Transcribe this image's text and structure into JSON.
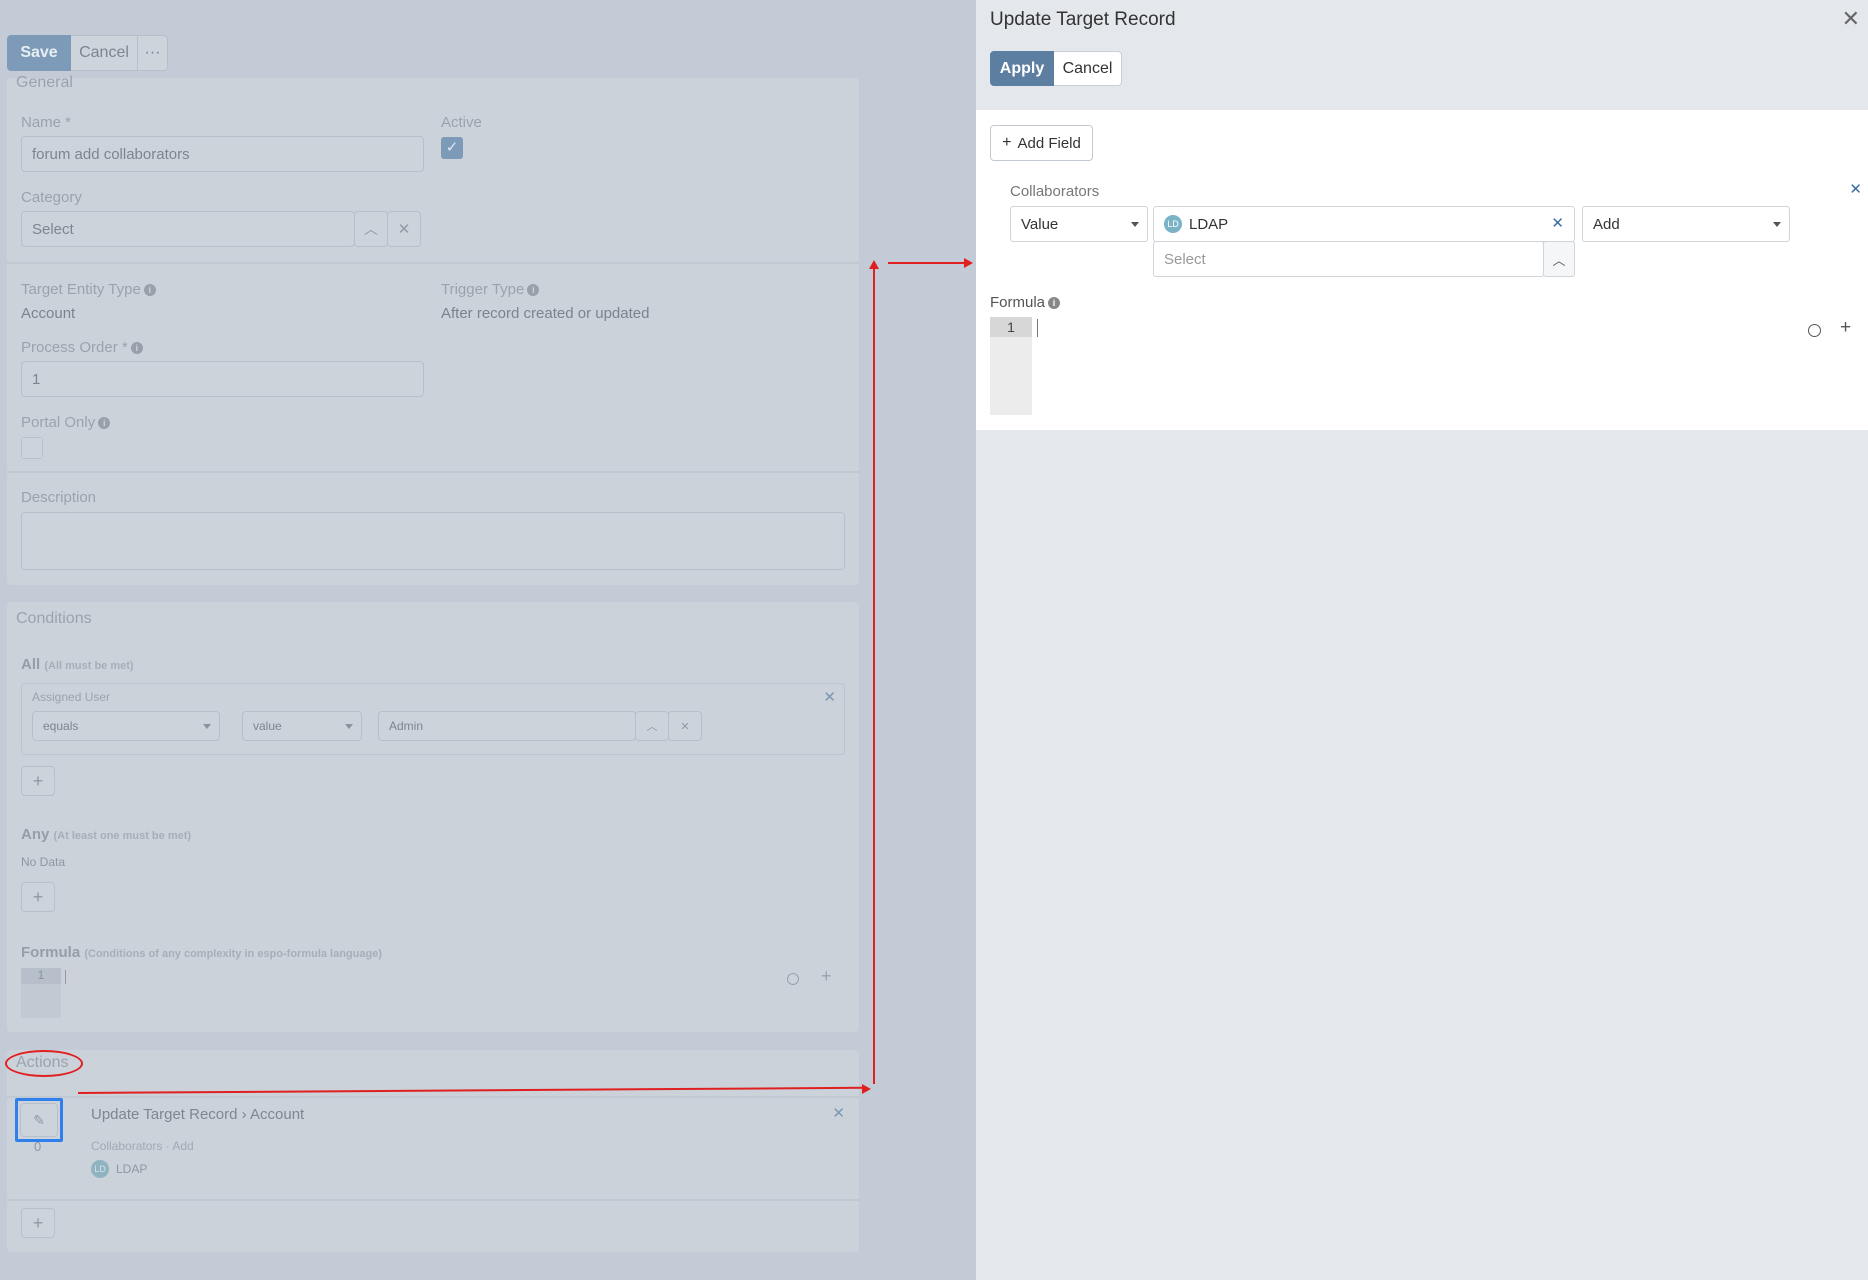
{
  "toolbar": {
    "save": "Save",
    "cancel": "Cancel",
    "more": "···"
  },
  "general": {
    "title": "General",
    "name_label": "Name *",
    "name_value": "forum add collaborators",
    "active_label": "Active",
    "category_label": "Category",
    "category_placeholder": "Select",
    "target_entity_label": "Target Entity Type",
    "target_entity_value": "Account",
    "trigger_type_label": "Trigger Type",
    "trigger_type_value": "After record created or updated",
    "process_order_label": "Process Order *",
    "process_order_value": "1",
    "portal_only_label": "Portal Only",
    "description_label": "Description"
  },
  "conditions": {
    "title": "Conditions",
    "all_label": "All",
    "all_note": "(All must be met)",
    "assigned_user_label": "Assigned User",
    "operator_value": "equals",
    "value_type": "value",
    "user_value": "Admin",
    "any_label": "Any",
    "any_note": "(At least one must be met)",
    "no_data": "No Data",
    "formula_label": "Formula",
    "formula_note": "(Conditions of any complexity in espo-formula language)",
    "line_number": "1"
  },
  "actions": {
    "title": "Actions",
    "action_title": "Update Target Record",
    "action_sep": "›",
    "action_entity": "Account",
    "action_sub": "Collaborators · Add",
    "badge_initials": "LD",
    "badge_label": "LDAP",
    "index": "0"
  },
  "modal": {
    "title": "Update Target Record",
    "apply": "Apply",
    "cancel": "Cancel",
    "add_field": "Add Field",
    "field_label": "Collaborators",
    "value_type": "Value",
    "selected_initials": "LD",
    "selected_value": "LDAP",
    "select_placeholder": "Select",
    "mode": "Add",
    "formula_label": "Formula",
    "line_number": "1"
  },
  "colors": {
    "accent": "#5b7ea1",
    "annotation_red": "#e02020",
    "highlight_blue": "#2f80ed"
  }
}
